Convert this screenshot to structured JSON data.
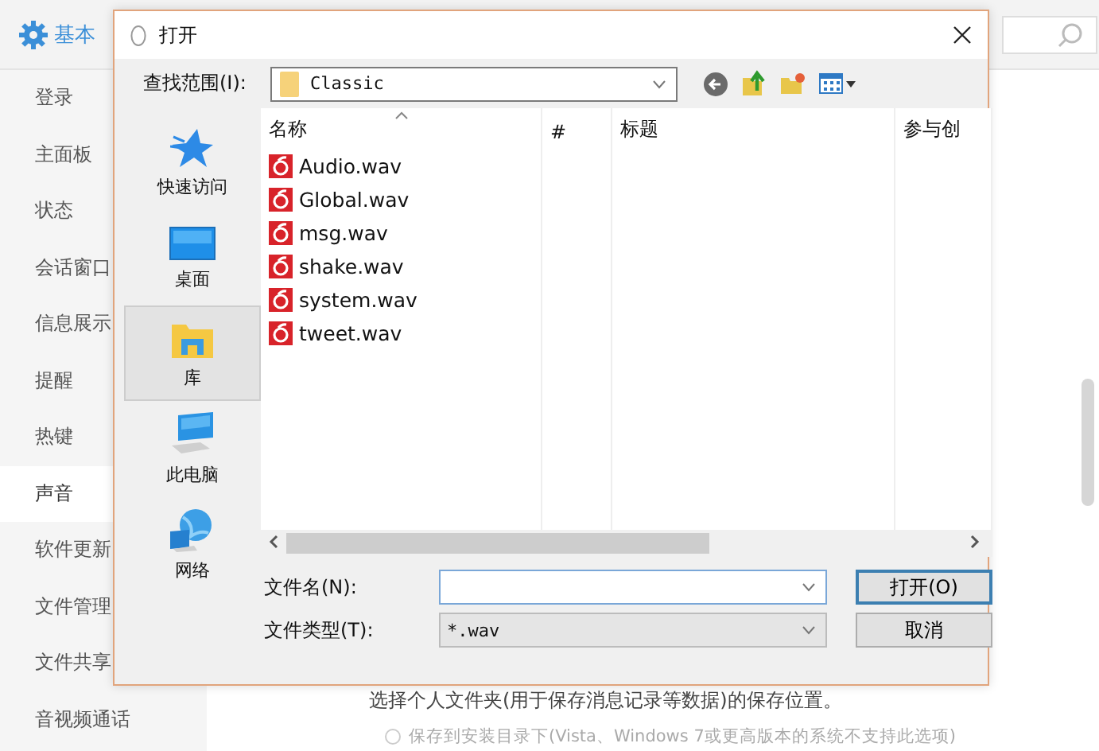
{
  "app": {
    "header": {
      "title": "基本"
    },
    "sidebar": {
      "items": [
        {
          "label": "登录",
          "selected": false
        },
        {
          "label": "主面板",
          "selected": false
        },
        {
          "label": "状态",
          "selected": false
        },
        {
          "label": "会话窗口",
          "selected": false
        },
        {
          "label": "信息展示",
          "selected": false
        },
        {
          "label": "提醒",
          "selected": false
        },
        {
          "label": "热键",
          "selected": false
        },
        {
          "label": "声音",
          "selected": true
        },
        {
          "label": "软件更新",
          "selected": false
        },
        {
          "label": "文件管理",
          "selected": false
        },
        {
          "label": "文件共享",
          "selected": false
        },
        {
          "label": "音视频通话",
          "selected": false
        }
      ]
    },
    "content": {
      "text": "选择个人文件夹(用于保存消息记录等数据)的保存位置。",
      "option": {
        "label": "保存到安装目录下(Vista、Windows 7或更高版本的系统不支持此选项)",
        "checked": false
      }
    }
  },
  "dialog": {
    "title": "打开",
    "look_in": {
      "label": "查找范围(I):",
      "value": "Classic"
    },
    "places": [
      {
        "label": "快速访问",
        "kind": "star",
        "selected": false
      },
      {
        "label": "桌面",
        "kind": "desktop",
        "selected": false
      },
      {
        "label": "库",
        "kind": "library",
        "selected": true
      },
      {
        "label": "此电脑",
        "kind": "computer",
        "selected": false
      },
      {
        "label": "网络",
        "kind": "network",
        "selected": false
      }
    ],
    "columns": [
      "名称",
      "#",
      "标题",
      "参与创"
    ],
    "files": [
      {
        "name": "Audio.wav"
      },
      {
        "name": "Global.wav"
      },
      {
        "name": "msg.wav"
      },
      {
        "name": "shake.wav"
      },
      {
        "name": "system.wav"
      },
      {
        "name": "tweet.wav"
      }
    ],
    "file_name": {
      "label": "文件名(N):"
    },
    "file_type": {
      "label": "文件类型(T):",
      "value": "*.wav"
    },
    "buttons": [
      "打开(O)",
      "取消"
    ]
  }
}
